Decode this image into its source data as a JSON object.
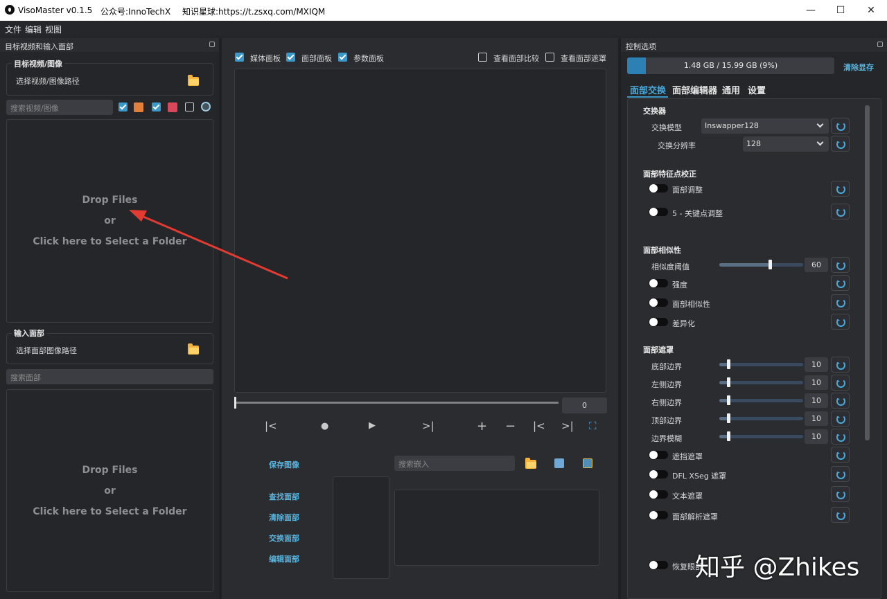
{
  "titlebar": {
    "app": "VisoMaster v0.1.5",
    "wechat": "公众号:InnoTechX",
    "planet": "知识星球:https://t.zsxq.com/MXIQM",
    "minimize": "—",
    "maximize": "☐",
    "close": "✕"
  },
  "menu": {
    "file": "文件",
    "edit": "编辑",
    "view": "视图"
  },
  "left": {
    "dock_title": "目标视频和输入面部",
    "target_group": "目标视频/图像",
    "target_path": "选择视频/图像路径",
    "search_videos": "搜索视频/图像",
    "drop1": {
      "l1": "Drop Files",
      "l2": "or",
      "l3": "Click here to Select a Folder"
    },
    "input_group": "输入面部",
    "input_path": "选择面部图像路径",
    "search_faces": "搜索面部",
    "drop2": {
      "l1": "Drop Files",
      "l2": "or",
      "l3": "Click here to Select a Folder"
    }
  },
  "center": {
    "cb_media": "媒体面板",
    "cb_faces": "面部面板",
    "cb_params": "参数面板",
    "cb_compare": "查看面部比较",
    "cb_mask": "查看面部遮罩",
    "frame": "0",
    "save_image": "保存图像",
    "search_embed": "搜索嵌入",
    "find_faces": "查找面部",
    "clear_faces": "清除面部",
    "swap_faces": "交换面部",
    "edit_faces": "编辑面部",
    "controls": {
      "prev": "|<",
      "record": "●",
      "play": "▶",
      "next": ">|",
      "add": "+",
      "remove": "−",
      "back": "|<",
      "fwd": ">|",
      "fit": "⛶"
    }
  },
  "right": {
    "dock_title": "控制选项",
    "vram_text": "1.48 GB / 15.99 GB (9%)",
    "vram_fraction": 0.09,
    "clear_vram": "清除显存",
    "tabs": [
      "面部交换",
      "面部编辑器",
      "通用",
      "设置"
    ],
    "swapper": {
      "title": "交换器",
      "model_label": "交换模型",
      "model_value": "Inswapper128",
      "res_label": "交换分辨率",
      "res_value": "128"
    },
    "landmark": {
      "title": "面部特征点校正",
      "t1": "面部调整",
      "t2": "5 - 关键点调整"
    },
    "similarity": {
      "title": "面部相似性",
      "threshold_label": "相似度阈值",
      "threshold_value": "60",
      "threshold_fraction": 0.6,
      "t1": "强度",
      "t2": "面部相似性",
      "t3": "差异化"
    },
    "mask": {
      "title": "面部遮罩",
      "bottom": "底部边界",
      "left": "左侧边界",
      "right": "右侧边界",
      "top": "顶部边界",
      "blur": "边界模糊",
      "v_bottom": "10",
      "v_left": "10",
      "v_right": "10",
      "v_top": "10",
      "v_blur": "10",
      "occluder": "遮挡遮罩",
      "xseg": "DFL XSeg 遮罩",
      "text": "文本遮罩",
      "parser": "面部解析遮罩",
      "restore": "恢复眼部"
    }
  },
  "watermark": "知乎 @Zhikes",
  "colors": {
    "accent": "#3a99c8",
    "bg": "#2b2c30",
    "panel": "#25262a"
  }
}
